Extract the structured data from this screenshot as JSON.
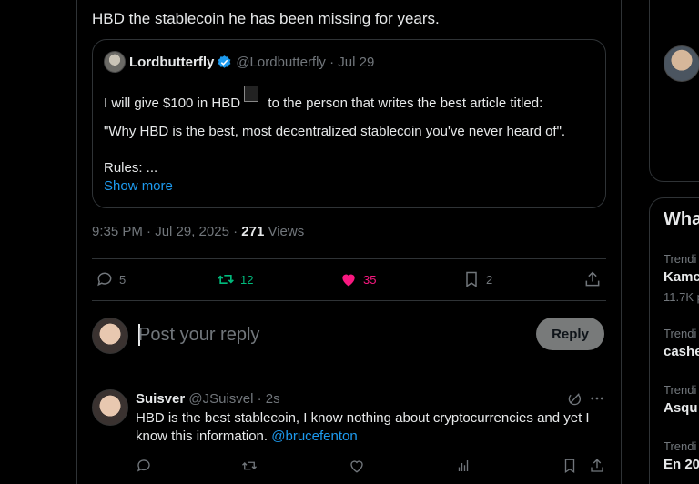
{
  "main_tweet": {
    "text_top_part1": "HBD the stablecoin he has been missing for years."
  },
  "quote": {
    "author_name": "Lordbutterfly",
    "handle_date": "@Lordbutterfly · Jul 29",
    "line1_a": "I will give $100 in HBD",
    "line1_b": "to the person that writes the best article titled:",
    "line2": "\"Why HBD is the best, most decentralized stablecoin you've never heard of\".",
    "line3": "Rules: ...",
    "show_more": "Show more"
  },
  "meta": {
    "time": "9:35 PM · Jul 29, 2025 · ",
    "views_count": "271",
    "views_label": " Views"
  },
  "actions": {
    "replies": "5",
    "reposts": "12",
    "likes": "35",
    "bookmarks": "2"
  },
  "reply_box": {
    "placeholder": "Post your reply",
    "button": "Reply"
  },
  "comment": {
    "name": "Suisver",
    "handle_time": "@JSuisvel · 2s",
    "text": "HBD is the best stablecoin, I know nothing about cryptocurrencies and yet I know this information.",
    "mention": "@brucefenton"
  },
  "sidebar": {
    "title": "Wha",
    "trends": [
      {
        "label": "Trendi",
        "name": "Kamc",
        "count": "11.7K p"
      },
      {
        "label": "Trendi",
        "name": "cashe",
        "count": ""
      },
      {
        "label": "Trendi",
        "name": "Asqu",
        "count": ""
      },
      {
        "label": "Trendi",
        "name": "En 20",
        "count": ""
      }
    ]
  },
  "colors": {
    "accent": "#1d9bf0",
    "repost_green": "#00ba7c",
    "like_pink": "#f91880",
    "muted": "#71767b"
  }
}
